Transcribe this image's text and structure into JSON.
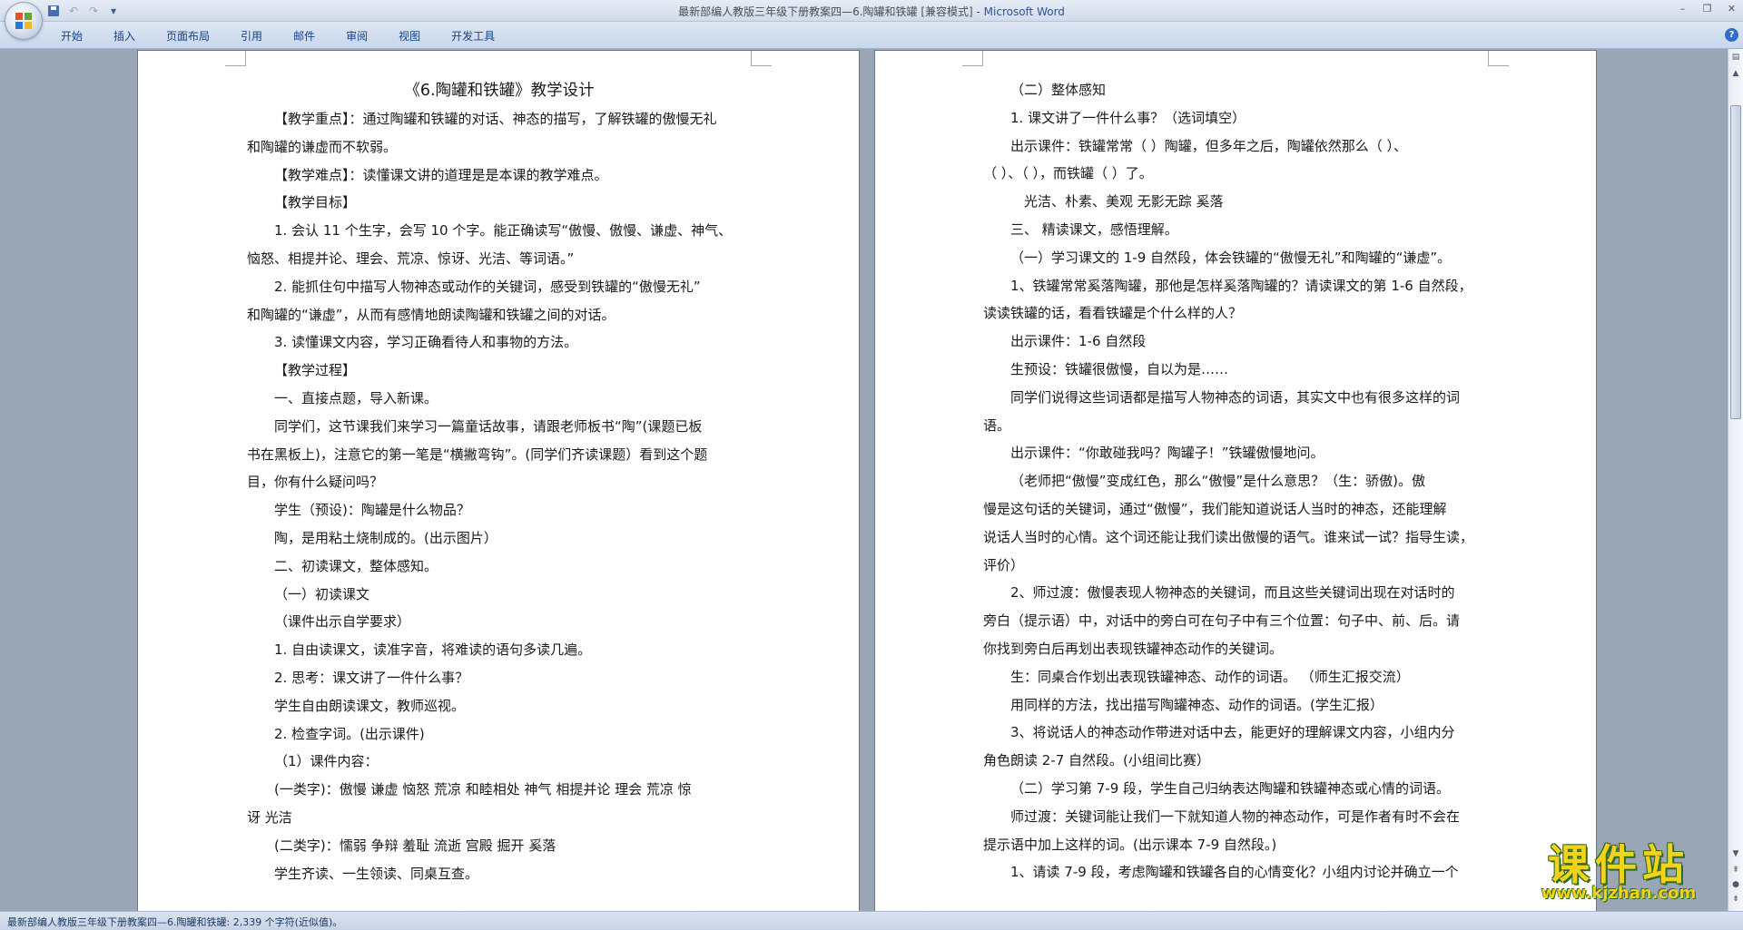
{
  "window": {
    "title_doc": "最新部编人教版三年级下册教案四—6.陶罐和铁罐 [兼容模式] - ",
    "title_app": "Microsoft Word"
  },
  "quick_access": {
    "save": "save-icon",
    "undo": "undo-icon",
    "redo": "redo-icon",
    "customize": "▾"
  },
  "window_controls": {
    "minimize": "–",
    "restore": "❐",
    "close": "✕"
  },
  "ribbon": {
    "tabs": [
      "开始",
      "插入",
      "页面布局",
      "引用",
      "邮件",
      "审阅",
      "视图",
      "开发工具"
    ],
    "help": "?"
  },
  "left_page": {
    "title": "《6.陶罐和铁罐》教学设计",
    "lines": [
      "【教学重点】：通过陶罐和铁罐的对话、神态的描写，了解铁罐的傲慢无礼",
      "和陶罐的谦虚而不软弱。",
      "【教学难点】：读懂课文讲的道理是是本课的教学难点。",
      "【教学目标】",
      "1. 会认 11 个生字，会写 10 个字。能正确读写“傲慢、傲慢、谦虚、神气、",
      "恼怒、相提并论、理会、荒凉、惊讶、光洁、等词语。”",
      "2. 能抓住句中描写人物神态或动作的关键词，感受到铁罐的“傲慢无礼”",
      "和陶罐的“谦虚”，从而有感情地朗读陶罐和铁罐之间的对话。",
      "3. 读懂课文内容，学习正确看待人和事物的方法。",
      "【教学过程】",
      "一、直接点题，导入新课。",
      "同学们，这节课我们来学习一篇童话故事，请跟老师板书“陶”(课题已板",
      "书在黑板上)，注意它的第一笔是“横撇弯钩”。(同学们齐读课题）看到这个题",
      "目，你有什么疑问吗？",
      "学生（预设)：陶罐是什么物品？",
      "陶，是用粘土烧制成的。(出示图片）",
      "二、初读课文，整体感知。",
      "（一）初读课文",
      "（课件出示自学要求）",
      "1. 自由读课文，读准字音，将难读的语句多读几遍。",
      "2. 思考：课文讲了一件什么事？",
      "学生自由朗读课文，教师巡视。",
      "2. 检查字词。(出示课件)",
      "（1）课件内容：",
      "(一类字)：傲慢 谦虚 恼怒 荒凉 和睦相处 神气 相提并论 理会 荒凉 惊",
      "讶 光洁",
      "(二类字)：懦弱 争辩 羞耻 流逝 宫殿 掘开 奚落",
      "学生齐读、一生领读、同桌互查。"
    ]
  },
  "right_page": {
    "lines": [
      "（二）整体感知",
      "1. 课文讲了一件什么事？（选词填空）",
      "出示课件：铁罐常常（          ）陶罐，但多年之后，陶罐依然那么（    ）、",
      "（    ）、（    ），而铁罐（              ）了。",
      "光洁、朴素、美观          无影无踪          奚落",
      "三、  精读课文，感悟理解。",
      "（一）学习课文的 1-9 自然段，体会铁罐的“傲慢无礼”和陶罐的“谦虚”。",
      "1、铁罐常常奚落陶罐，那他是怎样奚落陶罐的？请读课文的第 1-6 自然段，",
      "读读铁罐的话，看看铁罐是个什么样的人？",
      "出示课件：1-6 自然段",
      "生预设：铁罐很傲慢，自以为是……",
      "同学们说得这些词语都是描写人物神态的词语，其实文中也有很多这样的词",
      "语。",
      "出示课件：“你敢碰我吗？陶罐子！”铁罐傲慢地问。",
      "（老师把“傲慢”变成红色，那么“傲慢”是什么意思？（生：骄傲)。傲",
      "慢是这句话的关键词，通过“傲慢”，我们能知道说话人当时的神态，还能理解",
      "说话人当时的心情。这个词还能让我们读出傲慢的语气。谁来试一试？指导生读，",
      "评价）",
      "2、师过渡：傲慢表现人物神态的关键词，而且这些关键词出现在对话时的",
      "旁白（提示语）中，对话中的旁白可在句子中有三个位置：句子中、前、后。请",
      "你找到旁白后再划出表现铁罐神态动作的关键词。",
      "生：同桌合作划出表现铁罐神态、动作的词语。 （师生汇报交流）",
      "用同样的方法，找出描写陶罐神态、动作的词语。(学生汇报）",
      "3、将说话人的神态动作带进对话中去，能更好的理解课文内容，小组内分",
      "角色朗读 2-7 自然段。(小组间比赛）",
      "（二）学习第 7-9 段，学生自己归纳表达陶罐和铁罐神态或心情的词语。",
      "师过渡：关键词能让我们一下就知道人物的神态动作，可是作者有时不会在",
      "提示语中加上这样的词。(出示课本 7-9 自然段。)",
      "1、请读 7-9 段，考虑陶罐和铁罐各自的心情变化？小组内讨论并确立一个"
    ]
  },
  "status_bar": {
    "text": "最新部编人教版三年级下册教案四—6.陶罐和铁罐: 2,339 个字符(近似值)。"
  },
  "watermark": {
    "main": "课件站",
    "url": "www.kjzhan.com"
  },
  "colors": {
    "ribbon_text": "#15428b",
    "title_app": "#2b5797",
    "watermark": "#f2d21c"
  }
}
